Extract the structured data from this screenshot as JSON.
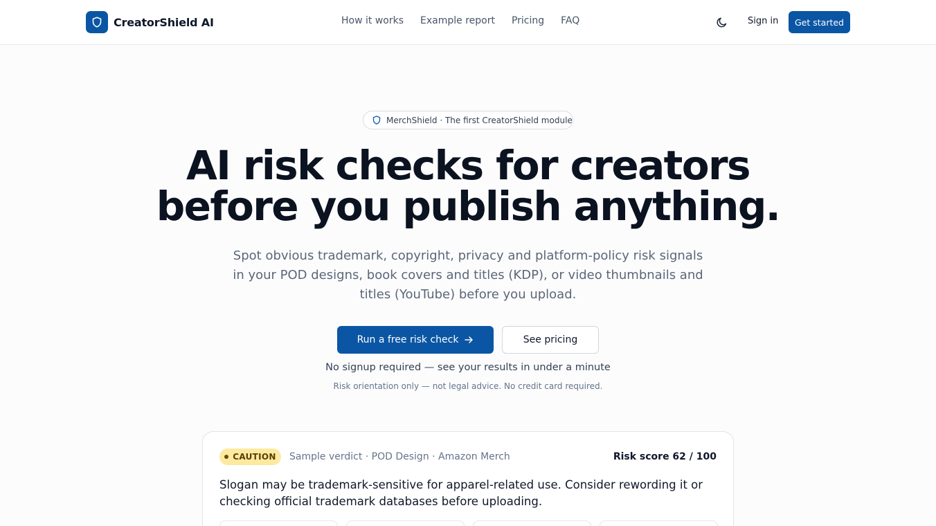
{
  "header": {
    "brand": "CreatorShield AI",
    "nav": [
      "How it works",
      "Example report",
      "Pricing",
      "FAQ"
    ],
    "sign_in": "Sign in",
    "get_started": "Get started",
    "icons": {
      "logo": "shield-icon",
      "theme": "moon-icon"
    }
  },
  "hero": {
    "badge": "MerchShield · The first CreatorShield module",
    "title_line1": "AI risk checks for creators",
    "title_line2": "before you publish anything.",
    "subtitle": "Spot obvious trademark, copyright, privacy and platform-policy risk signals in your POD designs, book covers and titles (KDP), or video thumbnails and titles (YouTube) before you upload.",
    "cta_primary": "Run a free risk check",
    "cta_secondary": "See pricing",
    "note_primary": "No signup required — see your results in under a minute",
    "note_secondary": "Risk orientation only — not legal advice. No credit card required."
  },
  "sample": {
    "verdict": "CAUTION",
    "meta": "Sample verdict · POD Design · Amazon Merch",
    "risk_score": "Risk score 62 / 100",
    "text": "Slogan may be trademark-sensitive for apparel-related use. Consider rewording it or checking official trademark databases before uploading."
  },
  "colors": {
    "primary": "#0b56a4",
    "caution_bg": "#fdeaa0",
    "caution_text": "#5a3d00"
  }
}
